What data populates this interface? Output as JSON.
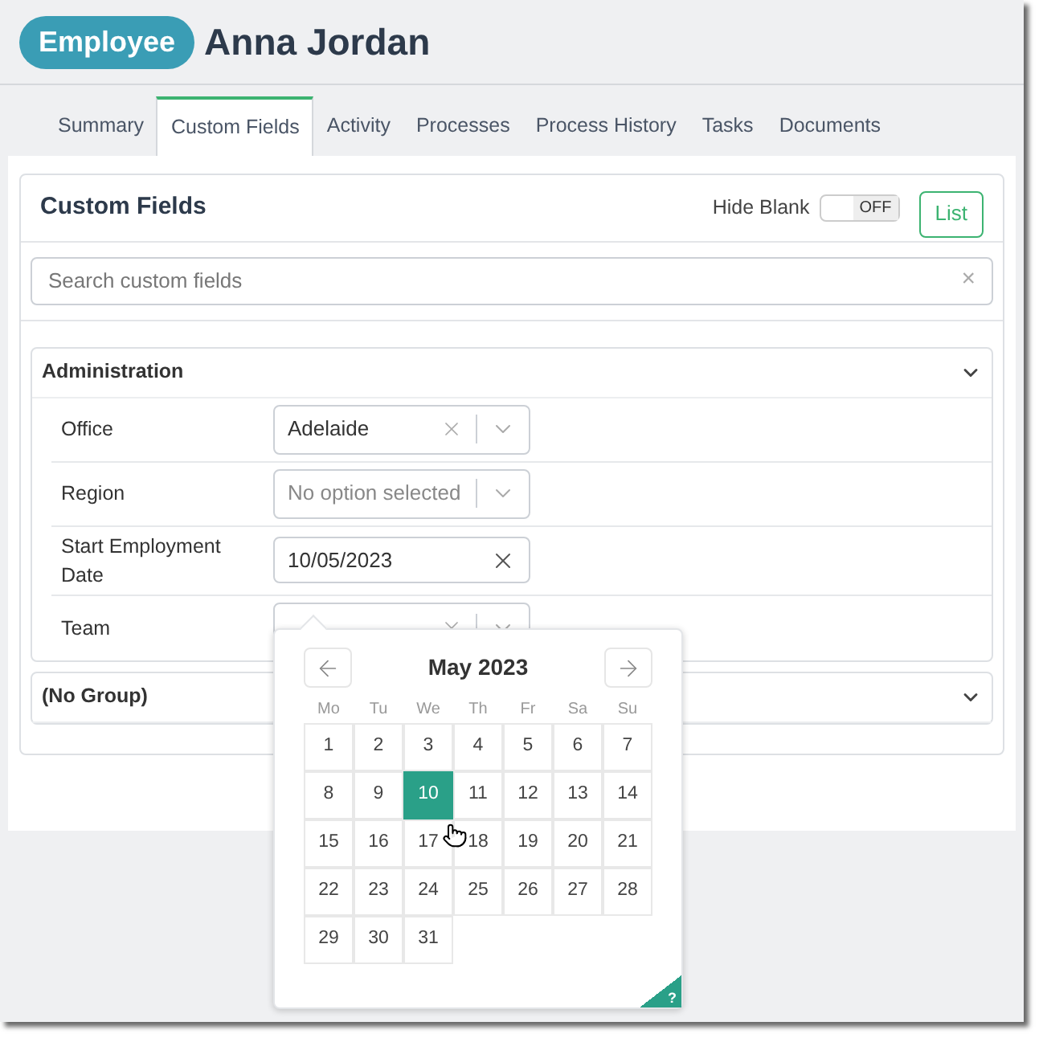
{
  "header": {
    "badge": "Employee",
    "name": "Anna Jordan"
  },
  "tabs": [
    {
      "label": "Summary",
      "selected": false
    },
    {
      "label": "Custom Fields",
      "selected": true
    },
    {
      "label": "Activity",
      "selected": false
    },
    {
      "label": "Processes",
      "selected": false
    },
    {
      "label": "Process History",
      "selected": false
    },
    {
      "label": "Tasks",
      "selected": false
    },
    {
      "label": "Documents",
      "selected": false
    }
  ],
  "card": {
    "title": "Custom Fields",
    "hide_blank": {
      "label": "Hide Blank",
      "on": false,
      "state_text": "OFF"
    },
    "list_button": "List"
  },
  "search": {
    "placeholder": "Search custom fields",
    "clear": "×"
  },
  "groups": [
    {
      "title": "Administration",
      "expanded": true,
      "fields": [
        {
          "label": "Office",
          "kind": "select",
          "value": "Adelaide"
        },
        {
          "label": "Region",
          "kind": "select",
          "placeholder": "No option selected"
        },
        {
          "label": "Start Employment Date",
          "kind": "date",
          "value": "10/05/2023"
        },
        {
          "label": "Team",
          "kind": "select"
        }
      ]
    },
    {
      "title": "(No Group)",
      "expanded": false
    }
  ],
  "calendar": {
    "title": "May 2023",
    "weekdays": [
      "Mo",
      "Tu",
      "We",
      "Th",
      "Fr",
      "Sa",
      "Su"
    ],
    "days": [
      {
        "label": "1",
        "selected": false
      },
      {
        "label": "2",
        "selected": false
      },
      {
        "label": "3",
        "selected": false
      },
      {
        "label": "4",
        "selected": false
      },
      {
        "label": "5",
        "selected": false
      },
      {
        "label": "6",
        "selected": false
      },
      {
        "label": "7",
        "selected": false
      },
      {
        "label": "8",
        "selected": false
      },
      {
        "label": "9",
        "selected": false
      },
      {
        "label": "10",
        "selected": true
      },
      {
        "label": "11",
        "selected": false
      },
      {
        "label": "12",
        "selected": false
      },
      {
        "label": "13",
        "selected": false
      },
      {
        "label": "14",
        "selected": false
      },
      {
        "label": "15",
        "selected": false
      },
      {
        "label": "16",
        "selected": false
      },
      {
        "label": "17",
        "selected": false
      },
      {
        "label": "18",
        "selected": false
      },
      {
        "label": "19",
        "selected": false
      },
      {
        "label": "20",
        "selected": false
      },
      {
        "label": "21",
        "selected": false
      },
      {
        "label": "22",
        "selected": false
      },
      {
        "label": "23",
        "selected": false
      },
      {
        "label": "24",
        "selected": false
      },
      {
        "label": "25",
        "selected": false
      },
      {
        "label": "26",
        "selected": false
      },
      {
        "label": "27",
        "selected": false
      },
      {
        "label": "28",
        "selected": false
      },
      {
        "label": "29",
        "selected": false
      },
      {
        "label": "30",
        "selected": false
      },
      {
        "label": "31",
        "selected": false
      }
    ],
    "help": "?"
  }
}
